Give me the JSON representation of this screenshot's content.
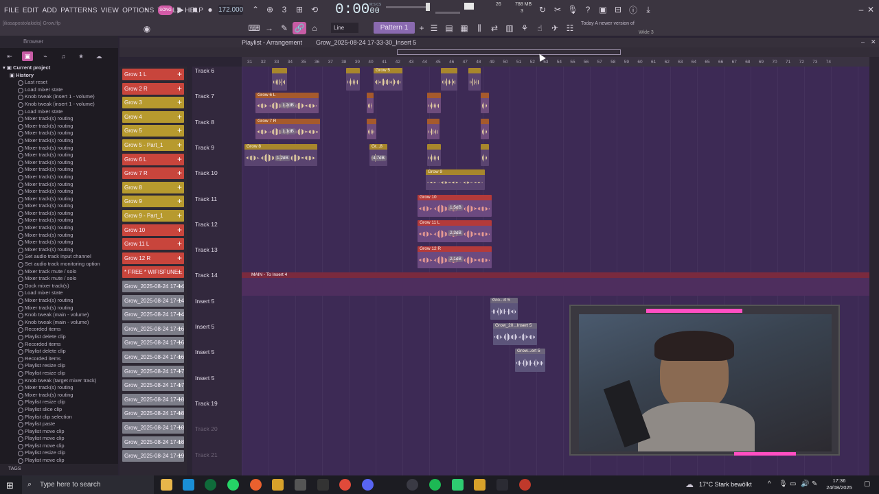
{
  "menu": [
    "FILE",
    "EDIT",
    "ADD",
    "PATTERNS",
    "VIEW",
    "OPTIONS",
    "TOOLS",
    "HELP"
  ],
  "transport": {
    "pat_song": "SONG",
    "tempo": "172.000",
    "time": "0:00",
    "time_sub": "00",
    "time_unit": "M:S:CS",
    "cpu": "26",
    "ram": "788 MB",
    "voices": "3"
  },
  "toolbar2": {
    "hint": "[iliasapostolakidis] Grow.flp",
    "snap": "Line",
    "pattern": "Pattern 1",
    "notice": "Today  A newer version of"
  },
  "browser": {
    "title": "Browser",
    "current_project": "Current project",
    "history": "History",
    "items": [
      "Last reset",
      "Load mixer state",
      "Knob tweak (insert 1 - volume)",
      "Knob tweak (insert 1 - volume)",
      "Load mixer state",
      "Mixer track(s) routing",
      "Mixer track(s) routing",
      "Mixer track(s) routing",
      "Mixer track(s) routing",
      "Mixer track(s) routing",
      "Mixer track(s) routing",
      "Mixer track(s) routing",
      "Mixer track(s) routing",
      "Mixer track(s) routing",
      "Mixer track(s) routing",
      "Mixer track(s) routing",
      "Mixer track(s) routing",
      "Mixer track(s) routing",
      "Mixer track(s) routing",
      "Mixer track(s) routing",
      "Mixer track(s) routing",
      "Mixer track(s) routing",
      "Mixer track(s) routing",
      "Mixer track(s) routing",
      "Set audio track input channel",
      "Set audio track monitoring option",
      "Mixer track mute / solo",
      "Mixer track mute / solo",
      "Dock mixer track(s)",
      "Load mixer state",
      "Mixer track(s) routing",
      "Mixer track(s) routing",
      "Knob tweak (main - volume)",
      "Knob tweak (main - volume)",
      "Recorded items",
      "Playlist delete clip",
      "Recorded items",
      "Playlist delete clip",
      "Recorded items",
      "Playlist resize clip",
      "Playlist resize clip",
      "Knob tweak (target mixer track)",
      "Mixer track(s) routing",
      "Mixer track(s) routing",
      "Playlist resize clip",
      "Playlist slice clip",
      "Playlist clip selection",
      "Playlist paste",
      "Playlist move clip",
      "Playlist move clip",
      "Playlist move clip",
      "Playlist resize clip",
      "Playlist move clip"
    ],
    "tags": "TAGS"
  },
  "playlist": {
    "title": "Playlist - Arrangement",
    "breadcrumb": "Grow_2025-08-24 17-33-30_Insert 5",
    "clip_sources": [
      {
        "label": "Grow 1 L",
        "color": "#c8453c"
      },
      {
        "label": "Grow 2 R",
        "color": "#c8453c"
      },
      {
        "label": "Grow 3",
        "color": "#b79a2e"
      },
      {
        "label": "Grow 4",
        "color": "#b79a2e"
      },
      {
        "label": "Grow 5",
        "color": "#b79a2e"
      },
      {
        "label": "Grow 5 - Part_1",
        "color": "#b79a2e"
      },
      {
        "label": "Grow 6 L",
        "color": "#c8453c"
      },
      {
        "label": "Grow 7 R",
        "color": "#c8453c"
      },
      {
        "label": "Grow 8",
        "color": "#b79a2e"
      },
      {
        "label": "Grow 9",
        "color": "#b79a2e"
      },
      {
        "label": "Grow 9 - Part_1",
        "color": "#b79a2e"
      },
      {
        "label": "Grow 10",
        "color": "#c8453c"
      },
      {
        "label": "Grow 11 L",
        "color": "#c8453c"
      },
      {
        "label": "Grow 12 R",
        "color": "#c8453c"
      },
      {
        "label": "* FREE * WIFISFUNE...",
        "color": "#c8453c"
      },
      {
        "label": "Grow_2025-08-24 17-14...",
        "color": "#7c7d88"
      },
      {
        "label": "Grow_2025-08-24 17-14...",
        "color": "#7c7d88"
      },
      {
        "label": "Grow_2025-08-24 17-14...",
        "color": "#7c7d88"
      },
      {
        "label": "Grow_2025-08-24 17-16...",
        "color": "#7c7d88"
      },
      {
        "label": "Grow_2025-08-24 17-16...",
        "color": "#7c7d88"
      },
      {
        "label": "Grow_2025-08-24 17-16...",
        "color": "#7c7d88"
      },
      {
        "label": "Grow_2025-08-24 17-17...",
        "color": "#7c7d88"
      },
      {
        "label": "Grow_2025-08-24 17-17...",
        "color": "#7c7d88"
      },
      {
        "label": "Grow_2025-08-24 17-18...",
        "color": "#7c7d88"
      },
      {
        "label": "Grow_2025-08-24 17-18...",
        "color": "#7c7d88"
      },
      {
        "label": "Grow_2025-08-24 17-18...",
        "color": "#7c7d88"
      },
      {
        "label": "Grow_2025-08-24 17-18...",
        "color": "#7c7d88"
      },
      {
        "label": "Grow_2025-08-24 17-19...",
        "color": "#7c7d88"
      }
    ],
    "tracks": [
      "Track 6",
      "Track 7",
      "Track 8",
      "Track 9",
      "Track 10",
      "Track 11",
      "Track 12",
      "Track 13",
      "Track 14",
      "Insert 5",
      "Insert 5",
      "Insert 5",
      "Insert 5",
      "Track 19",
      "Track 20",
      "Track 21"
    ],
    "ruler": [
      "31",
      "32",
      "33",
      "34",
      "35",
      "36",
      "37",
      "38",
      "39",
      "40",
      "41",
      "42",
      "43",
      "44",
      "45",
      "46",
      "47",
      "48",
      "49",
      "50",
      "51",
      "52",
      "53",
      "54",
      "55",
      "56",
      "57",
      "58",
      "59",
      "60",
      "61",
      "62",
      "63",
      "64",
      "65",
      "66",
      "67",
      "68",
      "69",
      "70",
      "71",
      "72",
      "73",
      "74"
    ],
    "clips": {
      "grow5": "Grow 5",
      "grow6l": "Grow 6 L",
      "grow7r": "Grow 7 R",
      "grow8": "Grow 8",
      "gr8": "Gr...8",
      "grow9": "Grow 9",
      "grow10": "Grow 10",
      "grow11l": "Grow 11 L",
      "grow12r": "Grow 12 R",
      "main": "MAIN - To Insert 4",
      "ins_a": "Gro...rt 5",
      "ins_b": "Grow_20...Insert 5",
      "ins_c": "Grow...ert 5"
    },
    "gains": {
      "g6": "1.2dB",
      "g7": "1.1dB",
      "g8": "1.2dB",
      "g8b": "4.7dB",
      "g10": "1.5dB",
      "g11": "2.3dB",
      "g12": "2.1dB"
    },
    "misc": {
      "wide": "Wide 3"
    }
  },
  "taskbar": {
    "search_placeholder": "Type here to search",
    "weather": "17°C  Stark bewölkt",
    "time": "17:36",
    "date": "24/08/2025"
  }
}
